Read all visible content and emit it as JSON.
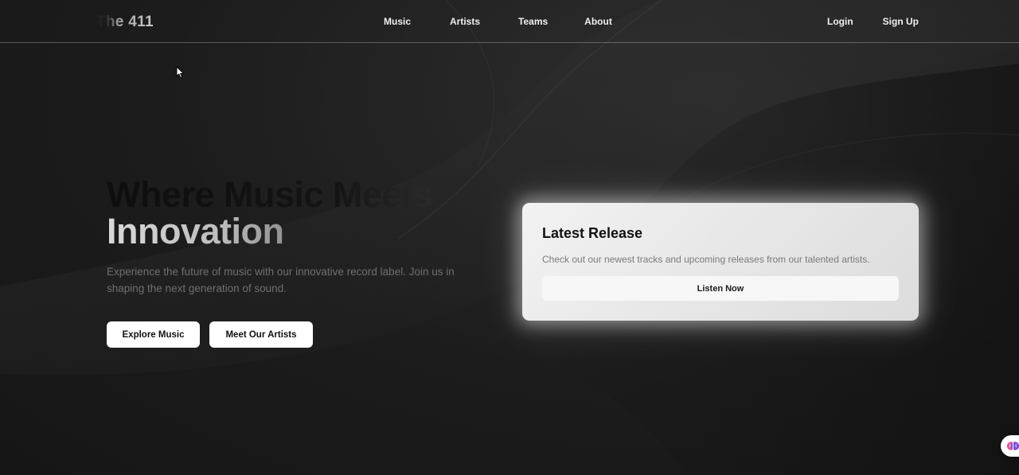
{
  "brand": {
    "name": "The 411"
  },
  "nav": {
    "links": [
      "Music",
      "Artists",
      "Teams",
      "About"
    ],
    "login_label": "Login",
    "signup_label": "Sign Up"
  },
  "hero": {
    "title_line1": "Where Music Meets",
    "title_line2": "Innovation",
    "description": "Experience the future of music with our innovative record label. Join us in shaping the next generation of sound.",
    "primary_button": "Explore Music",
    "secondary_button": "Meet Our Artists"
  },
  "release_card": {
    "title": "Latest Release",
    "description": "Check out our newest tracks and upcoming releases from our talented artists.",
    "button": "Listen Now"
  },
  "icons": {
    "cursor": "mouse-pointer-icon",
    "widget": "brain-icon"
  },
  "colors": {
    "background": "#1a1a1a",
    "text_light": "#f0f0f0",
    "card_bg": "#e8e8e8",
    "button_bg": "#ffffff",
    "widget_pink": "#e0559c",
    "widget_purple": "#7b4fd6"
  }
}
